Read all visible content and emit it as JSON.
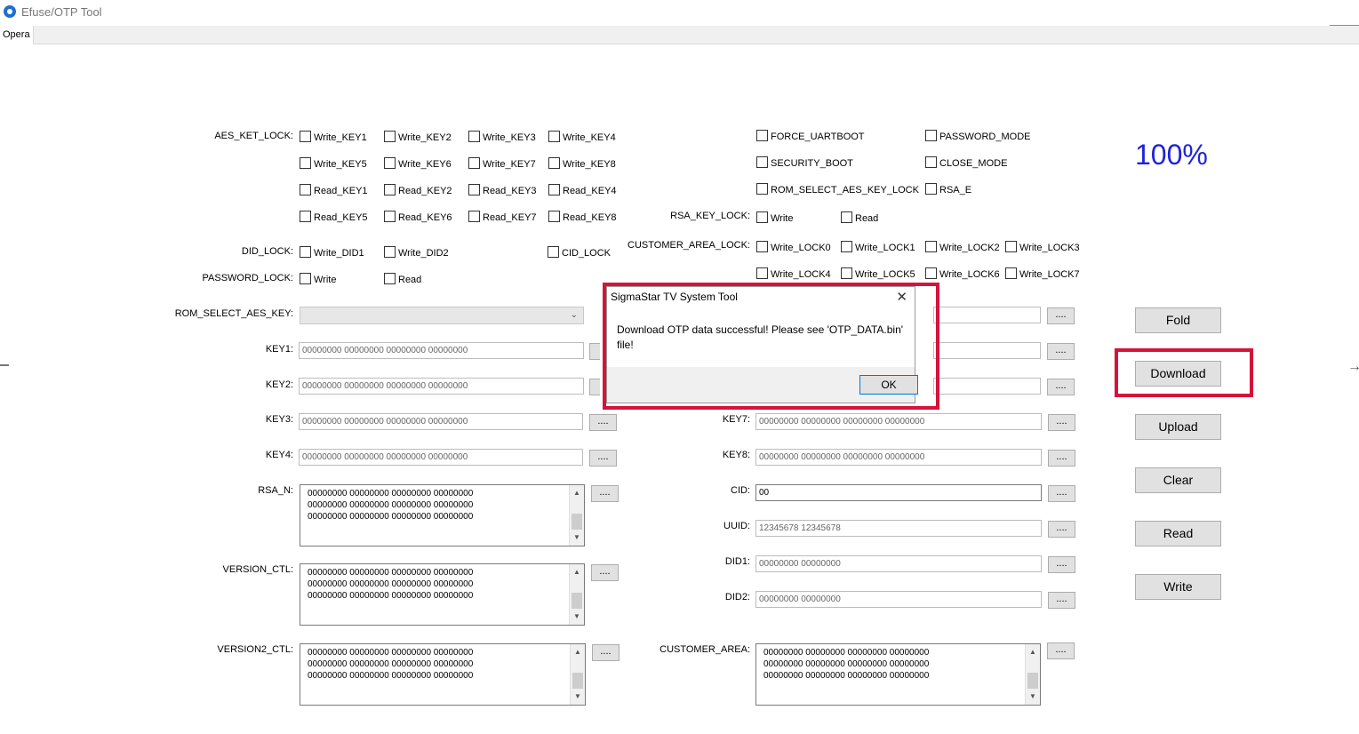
{
  "window": {
    "title": "Efuse/OTP Tool",
    "tab": "Opera"
  },
  "labels": {
    "aes_key_lock": "AES_KET_LOCK:",
    "did_lock": "DID_LOCK:",
    "password_lock": "PASSWORD_LOCK:",
    "rom_select_aes_key": "ROM_SELECT_AES_KEY:",
    "key1": "KEY1:",
    "key2": "KEY2:",
    "key3": "KEY3:",
    "key4": "KEY4:",
    "rsa_n": "RSA_N:",
    "version_ctl": "VERSION_CTL:",
    "version2_ctl": "VERSION2_CTL:",
    "rsa_key_lock": "RSA_KEY_LOCK:",
    "customer_area_lock": "CUSTOMER_AREA_LOCK:",
    "key7": "KEY7:",
    "key8": "KEY8:",
    "cid": "CID:",
    "uuid": "UUID:",
    "did1": "DID1:",
    "did2": "DID2:",
    "customer_area": "CUSTOMER_AREA:"
  },
  "checkboxes": {
    "write_key1": "Write_KEY1",
    "write_key2": "Write_KEY2",
    "write_key3": "Write_KEY3",
    "write_key4": "Write_KEY4",
    "write_key5": "Write_KEY5",
    "write_key6": "Write_KEY6",
    "write_key7": "Write_KEY7",
    "write_key8": "Write_KEY8",
    "read_key1": "Read_KEY1",
    "read_key2": "Read_KEY2",
    "read_key3": "Read_KEY3",
    "read_key4": "Read_KEY4",
    "read_key5": "Read_KEY5",
    "read_key6": "Read_KEY6",
    "read_key7": "Read_KEY7",
    "read_key8": "Read_KEY8",
    "write_did1": "Write_DID1",
    "write_did2": "Write_DID2",
    "cid_lock": "CID_LOCK",
    "pw_write": "Write",
    "pw_read": "Read",
    "force_uartboot": "FORCE_UARTBOOT",
    "password_mode": "PASSWORD_MODE",
    "security_boot": "SECURITY_BOOT",
    "close_mode": "CLOSE_MODE",
    "rom_select_aes_key_lock": "ROM_SELECT_AES_KEY_LOCK",
    "rsa_e": "RSA_E",
    "rsa_write": "Write",
    "rsa_read": "Read",
    "write_lock0": "Write_LOCK0",
    "write_lock1": "Write_LOCK1",
    "write_lock2": "Write_LOCK2",
    "write_lock3": "Write_LOCK3",
    "write_lock4": "Write_LOCK4",
    "write_lock5": "Write_LOCK5",
    "write_lock6": "Write_LOCK6",
    "write_lock7": "Write_LOCK7"
  },
  "fields": {
    "key_value": "00000000 00000000 00000000 00000000",
    "cid": "00",
    "uuid": "12345678 12345678",
    "did": "00000000 00000000",
    "area_text": "00000000 00000000 00000000 00000000\n00000000 00000000 00000000 00000000\n00000000 00000000 00000000 00000000"
  },
  "browse_label": "....",
  "progress": {
    "percent_text": "100%"
  },
  "buttons": {
    "fold": "Fold",
    "download": "Download",
    "upload": "Upload",
    "clear": "Clear",
    "read": "Read",
    "write": "Write"
  },
  "dialog": {
    "title": "SigmaStar TV System Tool",
    "message": "Download OTP data successful! Please see 'OTP_DATA.bin' file!",
    "ok": "OK"
  },
  "colors": {
    "progress_text": "#1f23d9",
    "highlight": "#d4143a"
  }
}
